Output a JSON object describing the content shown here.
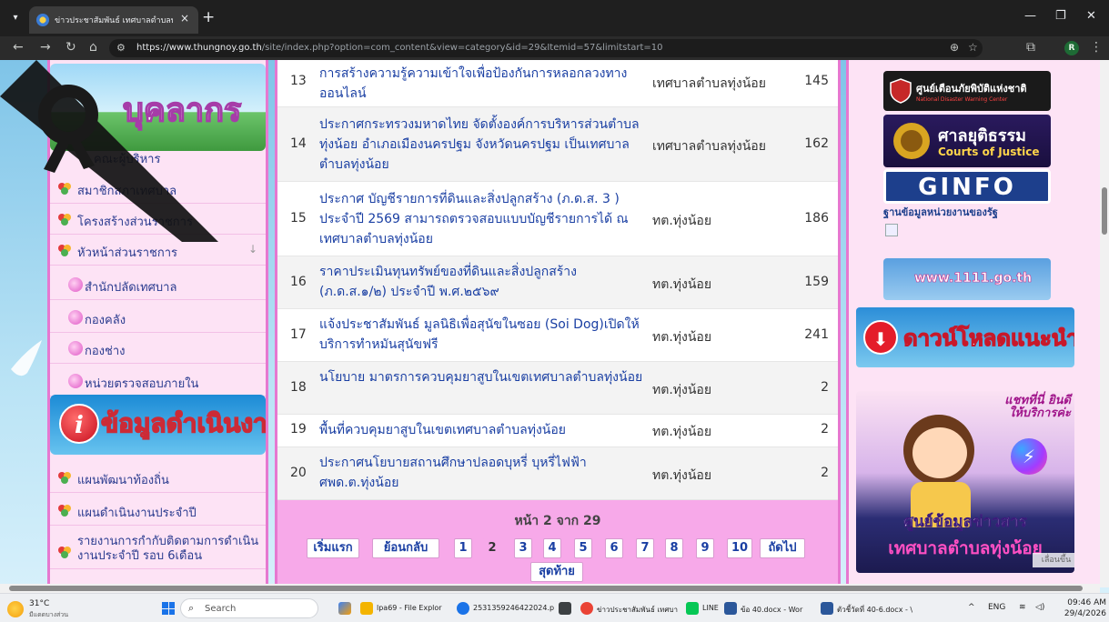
{
  "browser": {
    "tab_title": "ข่าวประชาสัมพันธ์ เทศบาลตำบลทุ่งน้อ",
    "tab_close": "×",
    "new_tab": "+",
    "url_host": "https://www.thungnoy.go.th",
    "url_path": "/site/index.php?option=com_content&view=category&id=29&Itemid=57&limitstart=10",
    "profile_initial": "R",
    "icons": [
      "back-icon",
      "forward-icon",
      "reload-icon",
      "home-icon",
      "zoom-icon",
      "star-icon",
      "extensions-icon",
      "menu-icon"
    ]
  },
  "left_menu": {
    "banner_people": "บุคลากร",
    "people_first_item": "คณะผู้บริหาร",
    "items": [
      {
        "label": "สมาชิกสภาเทศบาล"
      },
      {
        "label": "โครงสร้างส่วนราชการ"
      },
      {
        "label": "หัวหน้าส่วนราชการ"
      }
    ],
    "sub_items": [
      {
        "label": "สำนักปลัดเทศบาล"
      },
      {
        "label": "กองคลัง"
      },
      {
        "label": "กองช่าง"
      },
      {
        "label": "หน่วยตรวจสอบภายใน"
      }
    ],
    "banner_ops": "ข้อมูลดำเนินงาน",
    "ops_items": [
      {
        "label": "แผนพัฒนาท้องถิ่น"
      },
      {
        "label": "แผนดำเนินงานประจำปี"
      },
      {
        "label": "รายงานการกำกับติดตามการดำเนินงานประจำปี รอบ 6เดือน"
      }
    ]
  },
  "articles": [
    {
      "num": "13",
      "title": "การสร้างความรู้ความเข้าใจเพื่อป้องกันการหลอกลวงทางออนไลน์",
      "author": "เทศบาลตำบลทุ่งน้อย",
      "hits": "145"
    },
    {
      "num": "14",
      "title": "ประกาศกระทรวงมหาดไทย จัดตั้งองค์การบริหารส่วนตำบลทุ่งน้อย อำเภอเมืองนครปฐม จังหวัดนครปฐม เป็นเทศบาลตำบลทุ่งน้อย",
      "author": "เทศบาลตำบลทุ่งน้อย",
      "hits": "162"
    },
    {
      "num": "15",
      "title": "ประกาศ บัญชีรายการที่ดินและสิ่งปลูกสร้าง (ภ.ด.ส. 3 ) ประจำปี 2569 สามารถตรวจสอบแบบบัญชีรายการได้ ณ เทศบาลตำบลทุ่งน้อย",
      "author": "ทต.ทุ่งน้อย",
      "hits": "186"
    },
    {
      "num": "16",
      "title": "ราคาประเมินทุนทรัพย์ของที่ดินและสิ่งปลูกสร้าง (ภ.ด.ส.๑/๒) ประจำปี พ.ศ.๒๕๖๙",
      "author": "ทต.ทุ่งน้อย",
      "hits": "159"
    },
    {
      "num": "17",
      "title": "แจ้งประชาสัมพันธ์ มูลนิธิเพื่อสุนัขในซอย (Soi Dog)เปิดให้บริการทำหมันสุนัขฟรี",
      "author": "ทต.ทุ่งน้อย",
      "hits": "241"
    },
    {
      "num": "18",
      "title": "นโยบาย มาตรการควบคุมยาสูบในเขตเทศบาลตำบลทุ่งน้อย",
      "author": "ทต.ทุ่งน้อย",
      "hits": "2"
    },
    {
      "num": "19",
      "title": "พื้นที่ควบคุมยาสูบในเขตเทศบาลตำบลทุ่งน้อย",
      "author": "ทต.ทุ่งน้อย",
      "hits": "2"
    },
    {
      "num": "20",
      "title": "ประกาศนโยบายสถานศึกษาปลอดบุหรี่ บุหรี่ไฟฟ้า ศพด.ต.ทุ่งน้อย",
      "author": "ทต.ทุ่งน้อย",
      "hits": "2"
    }
  ],
  "pagination": {
    "counter": "หน้า 2 จาก 29",
    "first": "เริ่มแรก",
    "prev": "ย้อนกลับ",
    "pages": [
      "1",
      "2",
      "3",
      "4",
      "5",
      "6",
      "7",
      "8",
      "9",
      "10"
    ],
    "current": "2",
    "next": "ถัดไป",
    "last": "สุดท้าย"
  },
  "right_banners": {
    "warning_title": "ศูนย์เตือนภัยพิบัติแห่งชาติ",
    "warning_sub": "National Disaster Warning Center",
    "justice_title": "ศาลยุติธรรม",
    "justice_sub": "Courts of Justice",
    "gov_title": "GINFO",
    "gov_sub": "ฐานข้อมูลหน่วยงานของรัฐ",
    "site_1111": "www.1111.go.th",
    "download": "ดาวน์โหลดแนะนำ",
    "chat_bubble": "แชทที่นี่ ยินดีให้บริการค่ะ",
    "info_center": "ศูนย์ข้อมูลข่าวสาร",
    "municipality": "เทศบาลตำบลทุ่งน้อย",
    "scroll_tag": "เลื่อนขึ้น"
  },
  "taskbar": {
    "temp": "31°C",
    "weather": "มีแดดบางส่วน",
    "search": "Search",
    "apps": [
      {
        "label": "lpa69 - File Explor",
        "color": "#f4b400"
      },
      {
        "label": "2531359246422024.p",
        "color": "#1a73e8"
      },
      {
        "label": "ข่าวประชาสัมพันธ์ เทศบา",
        "color": "#ea4335"
      },
      {
        "label": "LINE",
        "color": "#06c755"
      },
      {
        "label": "ข้อ 40.docx - Wor",
        "color": "#2b579a"
      },
      {
        "label": "ตัวชี้วัดที่ 40-6.docx - \\",
        "color": "#2b579a"
      }
    ],
    "lang": "ENG",
    "time": "09:46 AM",
    "date": "29/4/2026"
  }
}
